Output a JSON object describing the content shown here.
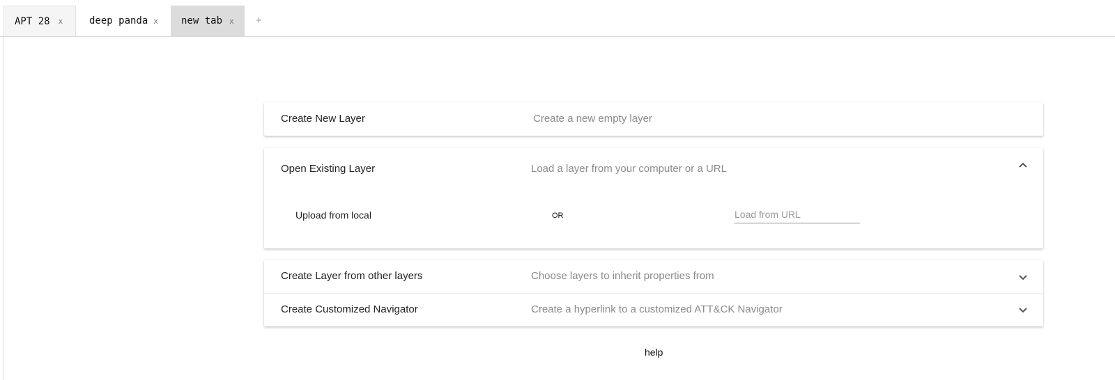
{
  "tabs": [
    {
      "label": "APT 28",
      "close": "x"
    },
    {
      "label": "deep panda",
      "close": "x"
    },
    {
      "label": "new tab",
      "close": "x",
      "active": true
    }
  ],
  "add_tab": "+",
  "panels": {
    "create_new": {
      "title": "Create New Layer",
      "description": "Create a new empty layer"
    },
    "open_existing": {
      "title": "Open Existing Layer",
      "description": "Load a layer from your computer or a URL",
      "expanded": true,
      "upload_label": "Upload from local",
      "or_label": "OR",
      "url_placeholder": "Load from URL",
      "url_value": ""
    },
    "from_other": {
      "title": "Create Layer from other layers",
      "description": "Choose layers to inherit properties from",
      "expanded": false
    },
    "customized": {
      "title": "Create Customized Navigator",
      "description": "Create a hyperlink to a customized ATT&CK Navigator",
      "expanded": false
    }
  },
  "help_label": "help",
  "icons": {
    "expanded": "chevron-up-icon",
    "collapsed": "chevron-down-icon"
  },
  "colors": {
    "active_tab": "#dcdcdc",
    "inactive_tab": "#f5f5f5",
    "description_text": "#8a8a8a"
  }
}
